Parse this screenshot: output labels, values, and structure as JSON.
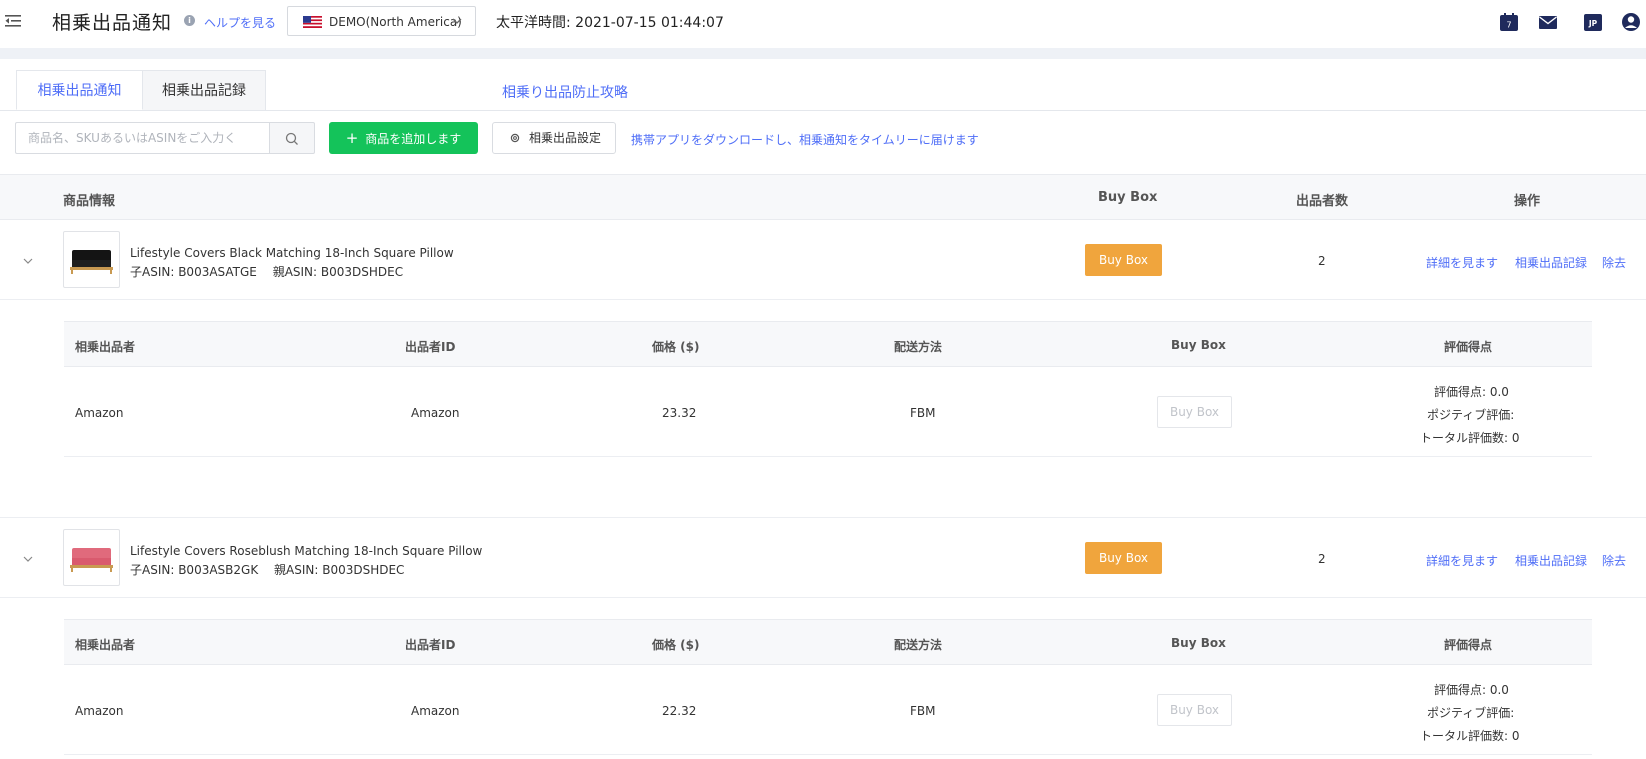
{
  "header": {
    "title": "相乗出品通知",
    "help_link": "ヘルプを見る",
    "region": "DEMO(North America)",
    "clock": "太平洋時間: 2021-07-15 01:44:07",
    "calendar_badge": "7",
    "lang_badge": "JP"
  },
  "tabs": [
    {
      "label": "相乗出品通知",
      "active": true
    },
    {
      "label": "相乗出品記録",
      "active": false
    }
  ],
  "strategy_link": "相乗り出品防止攻略",
  "toolbar": {
    "search_placeholder": "商品名、SKUあるいはASINをご入力く",
    "add_label": "商品を追加します",
    "settings_label": "相乗出品設定",
    "download_link": "携帯アプリをダウンロードし、相乗通知をタイムリーに届けます"
  },
  "main_table": {
    "headers": [
      "商品情報",
      "Buy Box",
      "出品者数",
      "操作"
    ]
  },
  "products": [
    {
      "name": "Lifestyle Covers Black Matching 18-Inch Square Pillow",
      "asin_line": "子ASIN: B003ASATGE　 親ASIN: B003DSHDEC",
      "buybox": "Buy Box",
      "seller_count": "2",
      "actions": [
        "詳細を見ます",
        "相乗出品記録",
        "除去"
      ],
      "sellers": [
        {
          "seller": "Amazon",
          "seller_id": "Amazon",
          "price": "23.32",
          "shipping": "FBM",
          "buybox": "Buy Box",
          "rating": [
            "評価得点: 0.0",
            "ポジティブ評価:",
            "トータル評価数: 0"
          ]
        }
      ]
    },
    {
      "name": "Lifestyle Covers Roseblush Matching 18-Inch Square Pillow",
      "asin_line": "子ASIN: B003ASB2GK　 親ASIN: B003DSHDEC",
      "buybox": "Buy Box",
      "seller_count": "2",
      "actions": [
        "詳細を見ます",
        "相乗出品記録",
        "除去"
      ],
      "sellers": [
        {
          "seller": "Amazon",
          "seller_id": "Amazon",
          "price": "22.32",
          "shipping": "FBM",
          "buybox": "Buy Box",
          "rating": [
            "評価得点: 0.0",
            "ポジティブ評価:",
            "トータル評価数: 0"
          ]
        }
      ]
    }
  ],
  "sub_table": {
    "headers": [
      "相乗出品者",
      "出品者ID",
      "価格 ($)",
      "配送方法",
      "Buy Box",
      "評価得点"
    ]
  },
  "colors": {
    "accent": "#4f6ef7",
    "add_button": "#14c35a",
    "buybox_active": "#f0a53d"
  }
}
